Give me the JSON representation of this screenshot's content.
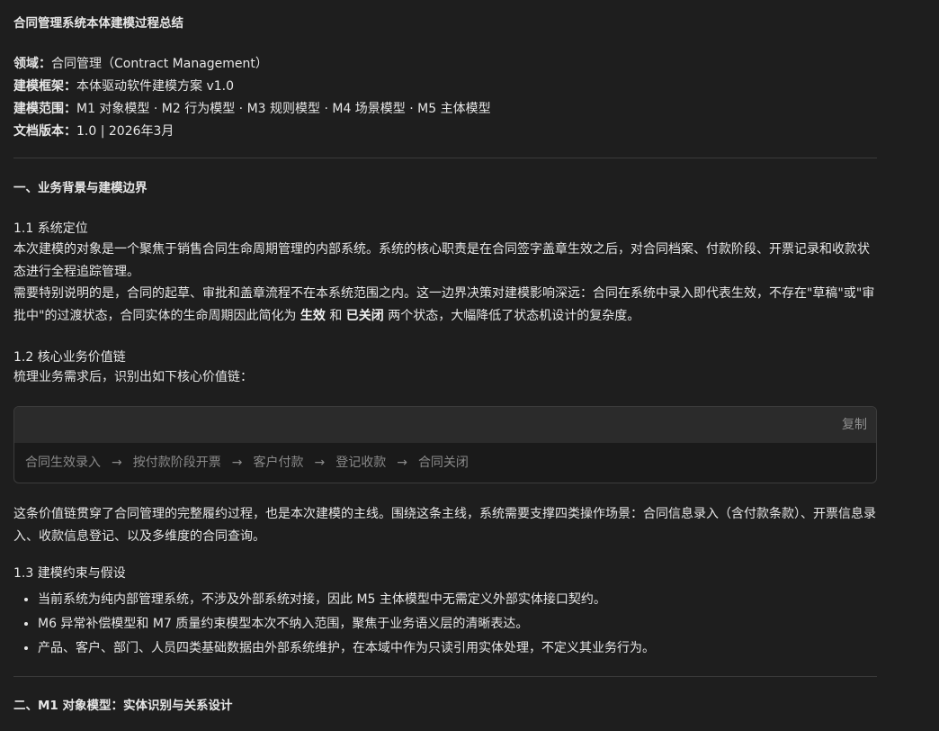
{
  "doc": {
    "title": "合同管理系统本体建模过程总结",
    "meta": [
      {
        "key": "领域：",
        "value": "合同管理（Contract Management）"
      },
      {
        "key": "建模框架：",
        "value": "本体驱动软件建模方案 v1.0"
      },
      {
        "key": "建模范围：",
        "value": "M1 对象模型 · M2 行为模型 · M3 规则模型 · M4 场景模型 · M5 主体模型"
      },
      {
        "key": "文档版本：",
        "value": "1.0 | 2026年3月"
      }
    ]
  },
  "section1": {
    "heading": "一、业务背景与建模边界",
    "sub1": {
      "heading": "1.1 系统定位",
      "para1": "本次建模的对象是一个聚焦于销售合同生命周期管理的内部系统。系统的核心职责是在合同签字盖章生效之后，对合同档案、付款阶段、开票记录和收款状态进行全程追踪管理。",
      "para2_before": "需要特别说明的是，合同的起草、审批和盖章流程不在本系统范围之内。这一边界决策对建模影响深远：合同在系统中录入即代表生效，不存在\"草稿\"或\"审批中\"的过渡状态，合同实体的生命周期因此简化为 ",
      "state_active": "生效",
      "para2_mid": " 和 ",
      "state_closed": "已关闭",
      "para2_after": " 两个状态，大幅降低了状态机设计的复杂度。"
    },
    "sub2": {
      "heading": "1.2 核心业务价值链",
      "intro": "梳理业务需求后，识别出如下核心价值链：",
      "copy_label": "复制",
      "chain": [
        "合同生效录入",
        "按付款阶段开票",
        "客户付款",
        "登记收款",
        "合同关闭"
      ],
      "arrow": "→",
      "after": "这条价值链贯穿了合同管理的完整履约过程，也是本次建模的主线。围绕这条主线，系统需要支撑四类操作场景：合同信息录入（含付款条款）、开票信息录入、收款信息登记、以及多维度的合同查询。"
    },
    "sub3": {
      "heading": "1.3 建模约束与假设",
      "bullets": [
        "当前系统为纯内部管理系统，不涉及外部系统对接，因此 M5 主体模型中无需定义外部实体接口契约。",
        "M6 异常补偿模型和 M7 质量约束模型本次不纳入范围，聚焦于业务语义层的清晰表达。",
        "产品、客户、部门、人员四类基础数据由外部系统维护，在本域中作为只读引用实体处理，不定义其业务行为。"
      ]
    }
  },
  "section2": {
    "heading": "二、M1 对象模型：实体识别与关系设计"
  }
}
